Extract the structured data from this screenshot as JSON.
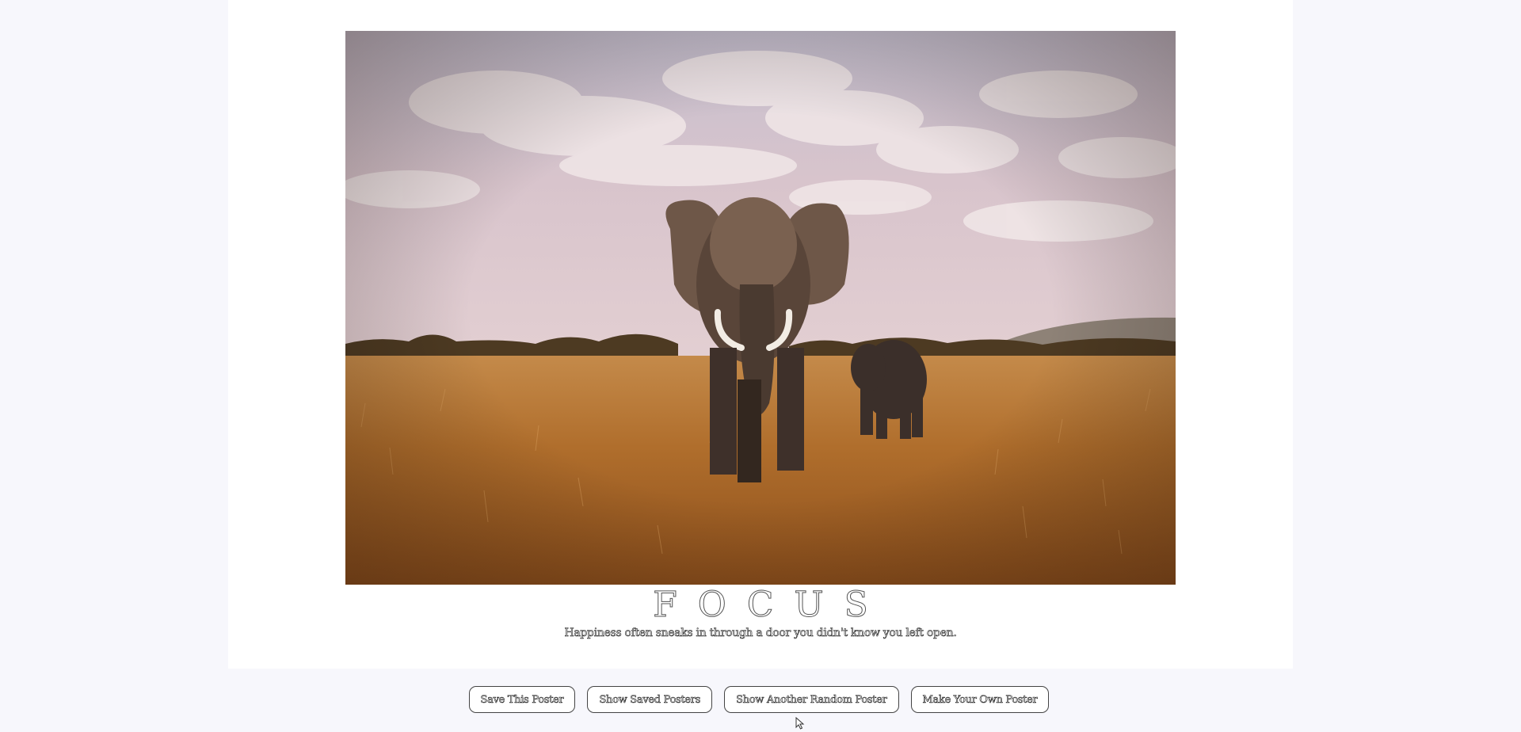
{
  "poster": {
    "image_subject": "elephants walking through golden savanna grass under a cloudy pink sky",
    "title": "FOCUS",
    "quote": "Happiness often sneaks in through a door you didn't know you left open."
  },
  "buttons": {
    "save": "Save This Poster",
    "show_saved": "Show Saved Posters",
    "show_random": "Show Another Random Poster",
    "make_own": "Make Your Own Poster"
  },
  "colors": {
    "page_background": "#f7f7fc",
    "poster_background": "#ffffff",
    "sky": "#d9c3c8",
    "grass": "#b8742e"
  }
}
